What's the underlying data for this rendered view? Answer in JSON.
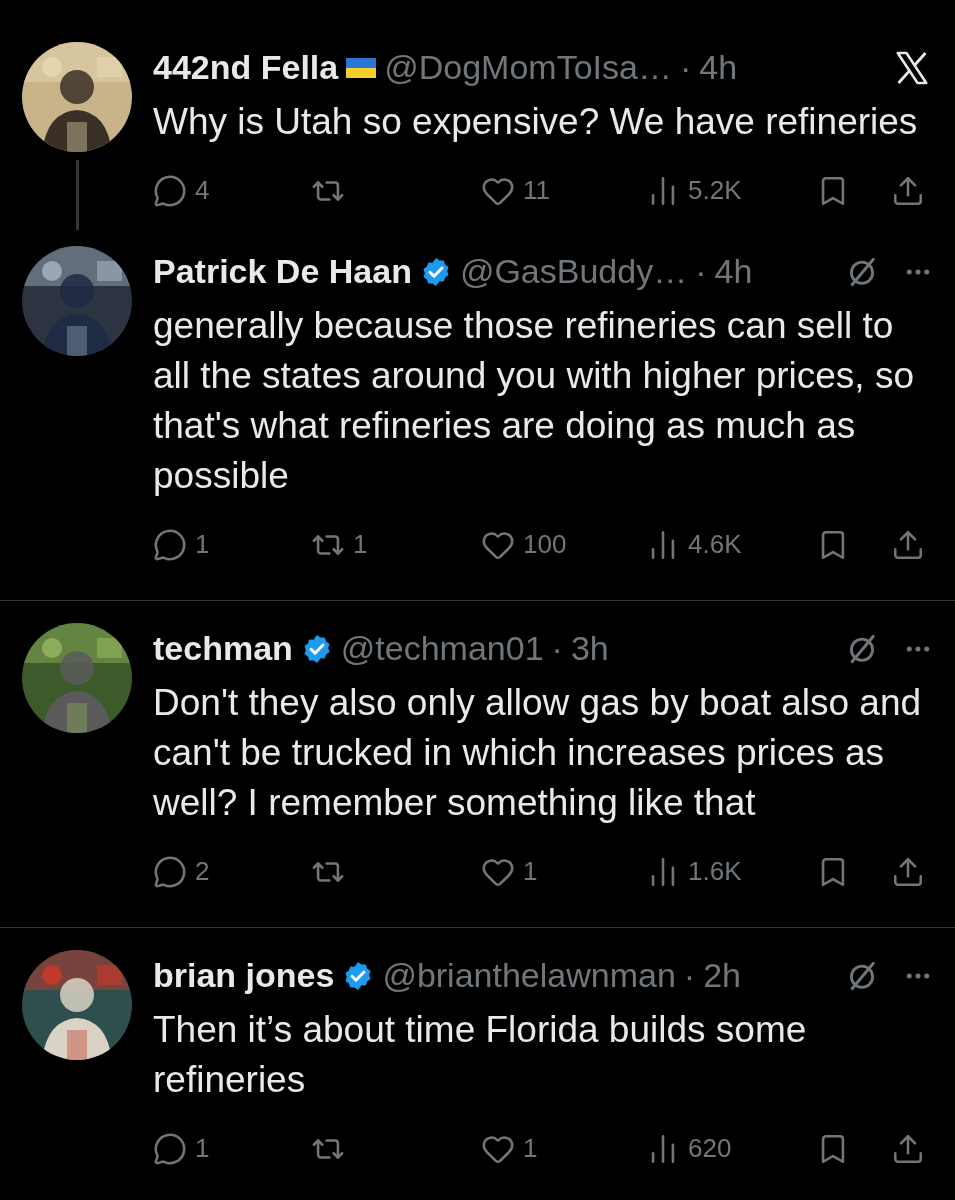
{
  "tweets": [
    {
      "kind": "root",
      "name": "442nd Fella",
      "flag": true,
      "verified": false,
      "handle": "@DogMomToIsa…",
      "dot": "·",
      "time": "4h",
      "thread_below": true,
      "text": "Why is Utah so expensive? We have refineries",
      "replies": "4",
      "likes": "11",
      "views": "5.2K"
    },
    {
      "kind": "reply",
      "name": "Patrick De Haan",
      "flag": false,
      "verified": true,
      "handle": "@GasBuddy…",
      "dot": "·",
      "time": "4h",
      "thread_below": false,
      "text": "generally because those refineries can sell to all the states around you with higher prices, so that's what refineries are doing as much as possible",
      "replies": "1",
      "reposts": "1",
      "likes": "100",
      "views": "4.6K"
    },
    {
      "kind": "reply",
      "name": "techman",
      "flag": false,
      "verified": true,
      "handle": "@techman01",
      "dot": "·",
      "time": "3h",
      "thread_below": false,
      "text": "Don't they also only allow gas by boat also and can't be trucked in which increases prices as well? I remember something like that",
      "replies": "2",
      "likes": "1",
      "views": "1.6K"
    },
    {
      "kind": "reply",
      "name": "brian jones",
      "flag": false,
      "verified": true,
      "handle": "@brianthelawnman",
      "dot": "·",
      "time": "2h",
      "thread_below": false,
      "text": "Then it’s about time Florida builds some refineries",
      "replies": "1",
      "likes": "1",
      "views": "620"
    }
  ]
}
